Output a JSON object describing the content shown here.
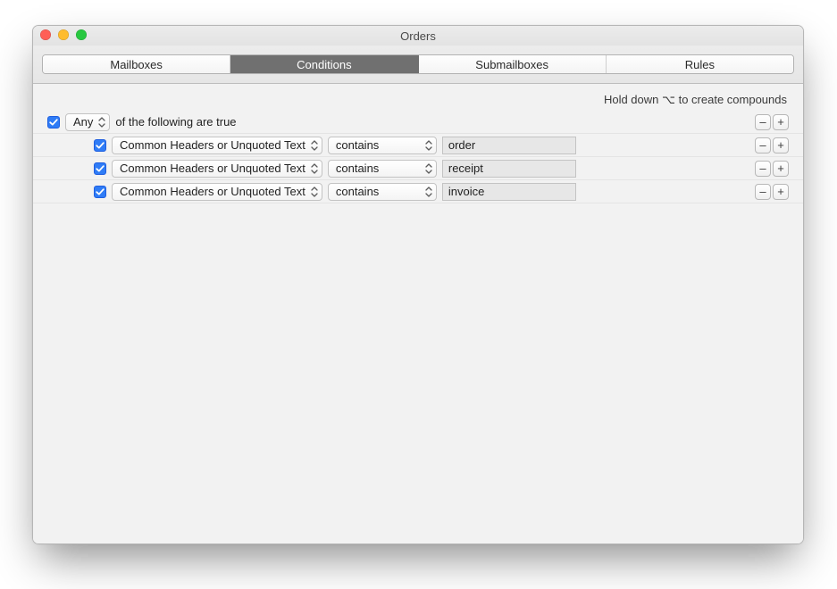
{
  "window": {
    "title": "Orders"
  },
  "tabs": [
    "Mailboxes",
    "Conditions",
    "Submailboxes",
    "Rules"
  ],
  "active_tab_index": 1,
  "hint": "Hold down ⌥ to create compounds",
  "parent_condition": {
    "match": "Any",
    "suffix": "of the following are true"
  },
  "conditions": [
    {
      "attribute": "Common Headers or Unquoted Text",
      "operator": "contains",
      "value": "order"
    },
    {
      "attribute": "Common Headers or Unquoted Text",
      "operator": "contains",
      "value": "receipt"
    },
    {
      "attribute": "Common Headers or Unquoted Text",
      "operator": "contains",
      "value": "invoice"
    }
  ],
  "buttons": {
    "minus": "–",
    "plus": "+"
  }
}
